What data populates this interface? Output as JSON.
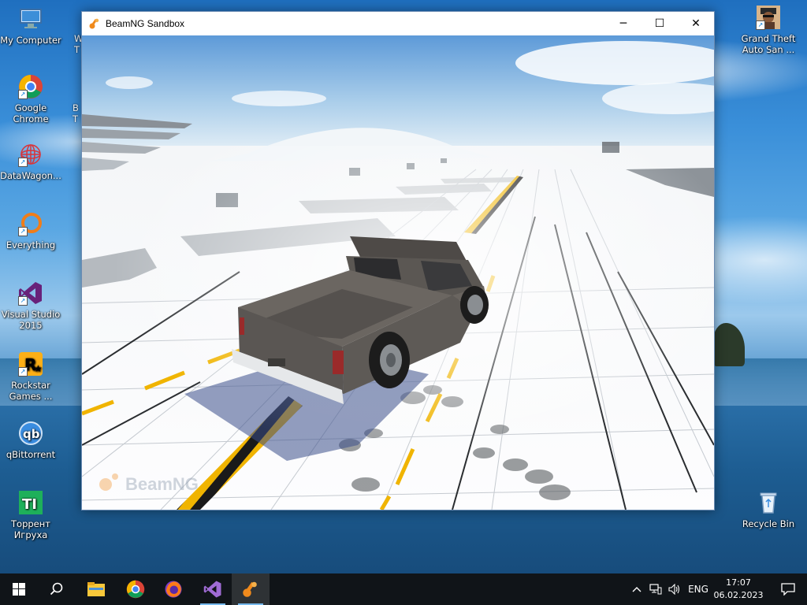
{
  "desktop": {
    "icons_left": [
      {
        "name": "my-computer",
        "label": "My Computer"
      },
      {
        "name": "google-chrome",
        "label": "Google\nChrome"
      },
      {
        "name": "datawagon",
        "label": "DataWagon..."
      },
      {
        "name": "everything",
        "label": "Everything"
      },
      {
        "name": "visual-studio",
        "label": "Visual Studio\n2015"
      },
      {
        "name": "rockstar-games",
        "label": "Rockstar\nGames ..."
      },
      {
        "name": "qbittorrent",
        "label": "qBittorrent"
      },
      {
        "name": "torrent-igruha",
        "label": "Торрент\nИгруха"
      }
    ],
    "partial_left_labels": [
      "W",
      "T",
      "B",
      "T"
    ],
    "icons_right": [
      {
        "name": "gta-san-andreas",
        "label": "Grand Theft\nAuto San ..."
      },
      {
        "name": "recycle-bin",
        "label": "Recycle Bin"
      }
    ]
  },
  "window": {
    "title": "BeamNG Sandbox",
    "watermark": "BeamNG",
    "buttons": {
      "minimize": "─",
      "maximize": "☐",
      "close": "✕"
    }
  },
  "taskbar": {
    "items": [
      "start-icon",
      "search-icon",
      "file-explorer-icon",
      "chrome-icon",
      "firefox-icon",
      "visual-studio-icon",
      "beamng-icon"
    ],
    "active_item": "beamng-icon",
    "tray": {
      "chevron": "^",
      "language": "ENG",
      "time": "17:07",
      "date": "06.02.2023"
    }
  },
  "colors": {
    "accent": "#76b9ed",
    "taskbar": "#101418",
    "truck_body": "#5b5753",
    "hazard_yellow": "#f0b400"
  }
}
